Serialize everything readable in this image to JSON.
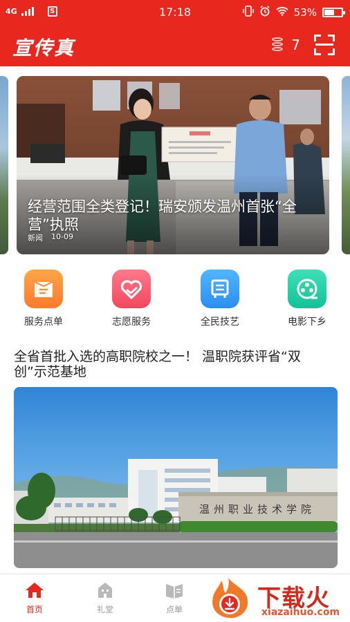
{
  "status_bar": {
    "network": "4G",
    "time": "17:18",
    "battery": "53%"
  },
  "app_bar": {
    "logo": "宣传真",
    "coin_count": "7"
  },
  "carousel": {
    "active_slide": {
      "title": "经营范围全类登记！瑞安颁发温州首张“全营”执照",
      "category": "新闻",
      "date": "10-09"
    }
  },
  "quick_menu": [
    {
      "label": "服务点单",
      "icon": "menu-list-icon"
    },
    {
      "label": "志愿服务",
      "icon": "heart-hand-icon"
    },
    {
      "label": "全民技艺",
      "icon": "frame-icon"
    },
    {
      "label": "电影下乡",
      "icon": "film-reel-icon"
    }
  ],
  "article": {
    "title": "全省首批入选的高职院校之一！ 温职院获评省“双创”示范基地",
    "image_sign": "温州职业技术学院"
  },
  "bottom_nav": [
    {
      "label": "首页",
      "icon": "home-icon",
      "active": true
    },
    {
      "label": "礼堂",
      "icon": "hall-icon",
      "active": false
    },
    {
      "label": "点单",
      "icon": "order-icon",
      "active": false
    }
  ],
  "watermark": {
    "text": "下载火",
    "url": "xiazaihuo.com"
  },
  "colors": {
    "primary": "#e8271f",
    "nav_inactive": "#9a9a9a"
  }
}
